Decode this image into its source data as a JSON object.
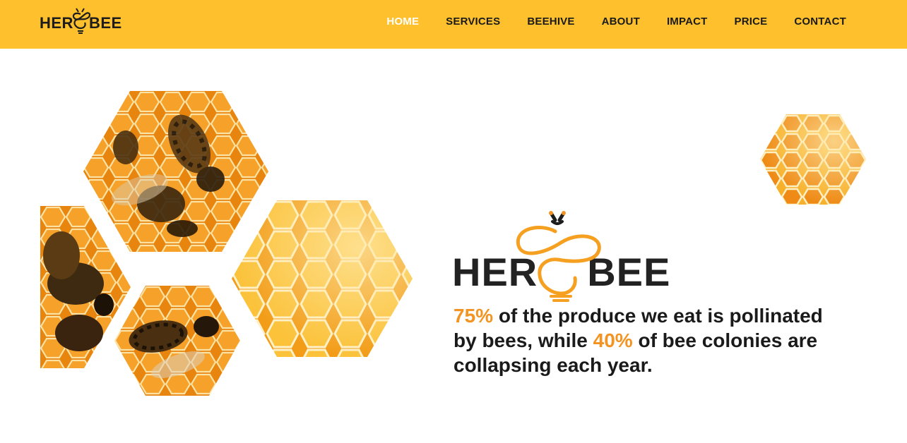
{
  "header": {
    "logo_text": "HEROBEE",
    "logo_left": "HER",
    "logo_right": "BEE",
    "bg_color": "#FEC12D"
  },
  "nav": {
    "items": [
      {
        "label": "HOME",
        "active": true
      },
      {
        "label": "SERVICES",
        "active": false
      },
      {
        "label": "BEEHIVE",
        "active": false
      },
      {
        "label": "ABOUT",
        "active": false
      },
      {
        "label": "IMPACT",
        "active": false
      },
      {
        "label": "PRICE",
        "active": false
      },
      {
        "label": "CONTACT",
        "active": false
      }
    ]
  },
  "hero": {
    "brand_left": "HER",
    "brand_right": "BEE",
    "stat_pct1": "75%",
    "stat_text1": " of the produce we eat is pollinated by bees, while ",
    "stat_pct2": "40%",
    "stat_text2": " of bee colonies are collapsing each year.",
    "accent_color": "#F39422"
  },
  "images": [
    {
      "name": "bees-on-honeycomb-hexagon"
    },
    {
      "name": "bees-left-partial-hexagon"
    },
    {
      "name": "bee-small-hexagon"
    },
    {
      "name": "honeycomb-large-hexagon"
    },
    {
      "name": "honeycomb-corner-hexagon"
    }
  ]
}
